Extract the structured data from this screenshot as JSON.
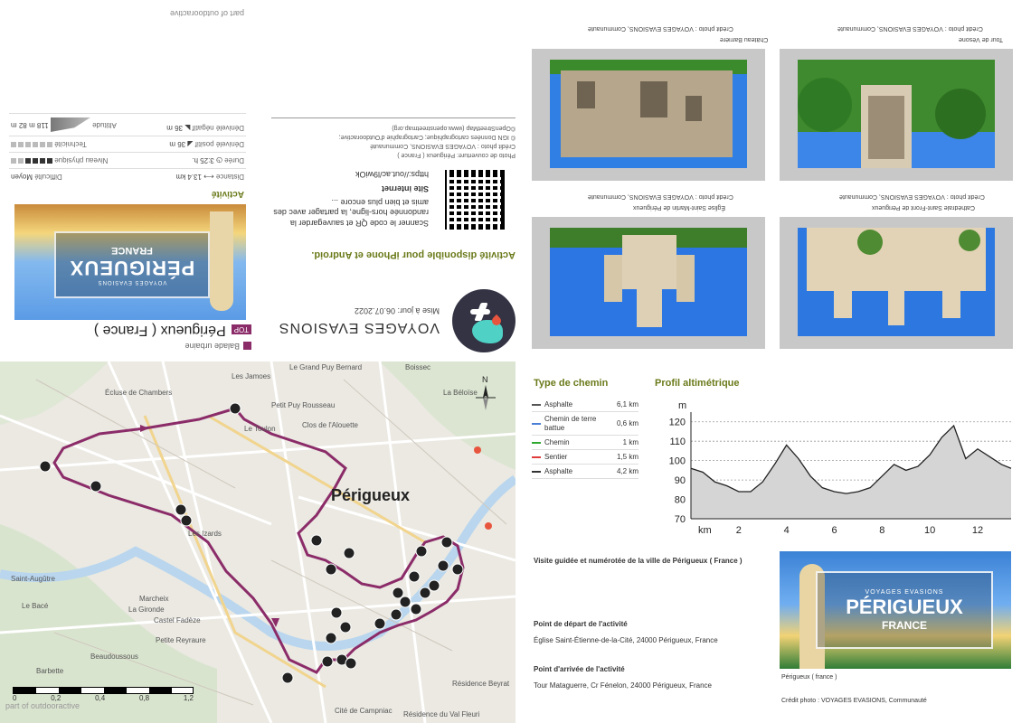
{
  "brand": {
    "name": "VOYAGES EVASIONS",
    "updated": "Mise à jour: 06.07.2022"
  },
  "activity_type": "Balade urbaine",
  "top_badge": "TOP",
  "title": "Périgueux ( France )",
  "cover": {
    "top_text": "VOYAGES EVASIONS",
    "big_text": "PÉRIGUEUX",
    "small_text": "FRANCE"
  },
  "app_line": "Activité disponible pour iPhone et Android.",
  "qr_text": "Scanner le code QR et sauvegarder la randonnée hors-ligne, la partager avec des amis et bien plus encore ...",
  "site_heading": "Site internet",
  "site_url": "https://out.ac/l9wiOk",
  "credits": {
    "line1": "Photo de couverture: Périgueux ( France )",
    "line2": "Crédit photo : VOYAGES EVASIONS, Communauté",
    "line3": "© IGN Données cartographique; Cartographie d'Outdooractive;",
    "line4": "©OpenStreetMap (www.openstreetmap.org)"
  },
  "activity_heading": "Activité",
  "stats": {
    "distance_label": "Distance",
    "distance": "13.4 km",
    "difficulty_label": "Difficulté",
    "difficulty": "Moyen",
    "duration_label": "Durée",
    "duration": "3:25 h.",
    "physical_label": "Niveau physique",
    "physical_level": 4,
    "physical_max": 6,
    "ascent_label": "Dénivelé positif",
    "ascent": "36 m",
    "technique_label": "Technicité",
    "technique_level": 0,
    "technique_max": 6,
    "descent_label": "Dénivelé négatif",
    "descent": "36 m",
    "altitude_label": "Altitude",
    "alt_max": "118 m",
    "alt_min": "82 m"
  },
  "outdoor_footer": "part of outdooractive",
  "map": {
    "city": "Périgueux",
    "labels": [
      "Le Grand Puy Bernard",
      "Les Jamoes",
      "Écluse de Chambers",
      "Petit Puy Rousseau",
      "Clos de l'Alouette",
      "Boissec",
      "Saint-Augûtre",
      "Le Toulon",
      "La Béloïse",
      "Cité de Campniac",
      "Résidence du Val Fleuri",
      "Résidence Beyrat",
      "Marcheix",
      "La Gironde",
      "Castel Fadèze",
      "Petite Reyraure",
      "Beaudoussous",
      "Barbette",
      "Le Bacé",
      "Les Izards"
    ],
    "scale": [
      "0",
      "0,2",
      "0,4",
      "0,8",
      "1,2"
    ],
    "watermark": "part of outdooractive"
  },
  "photos": [
    {
      "title": "Tour de Vésone",
      "credit": "Crédit photo : VOYAGES EVASIONS, Communauté"
    },
    {
      "title": "Château Barrière",
      "credit": "Crédit photo : VOYAGES EVASIONS, Communauté"
    },
    {
      "title": "Cathédrale Saint-Front de Périgueux",
      "credit": "Crédit photo : VOYAGES EVASIONS, Communauté"
    },
    {
      "title": "Église Saint-Martin de Périgueux",
      "credit": "Crédit photo : VOYAGES EVASIONS, Communauté"
    }
  ],
  "path_types": {
    "title": "Type de chemin",
    "items": [
      {
        "name": "Asphalte",
        "length": "6,1 km",
        "color": "#555555"
      },
      {
        "name": "Chemin de terre battue",
        "length": "0,6 km",
        "color": "#4a7fd6"
      },
      {
        "name": "Chemin",
        "length": "1 km",
        "color": "#2fa82f"
      },
      {
        "name": "Sentier",
        "length": "1,5 km",
        "color": "#e03c3c"
      },
      {
        "name": "Asphalte",
        "length": "4,2 km",
        "color": "#333333"
      }
    ]
  },
  "profile": {
    "title": "Profil altimétrique",
    "y_unit": "m",
    "x_unit": "km"
  },
  "chart_data": {
    "type": "area",
    "title": "Profil altimétrique",
    "xlabel": "km",
    "ylabel": "m",
    "xlim": [
      0,
      13.4
    ],
    "ylim": [
      70,
      125
    ],
    "x_ticks": [
      2,
      4,
      6,
      8,
      10,
      12
    ],
    "y_ticks": [
      70,
      80,
      90,
      100,
      110,
      120
    ],
    "x": [
      0,
      0.5,
      1,
      1.5,
      2,
      2.5,
      3,
      3.5,
      4,
      4.5,
      5,
      5.5,
      6,
      6.5,
      7,
      7.5,
      8,
      8.5,
      9,
      9.5,
      10,
      10.5,
      11,
      11.5,
      12,
      12.5,
      13,
      13.4
    ],
    "values": [
      96,
      94,
      89,
      87,
      84,
      84,
      89,
      98,
      108,
      101,
      92,
      86,
      84,
      83,
      84,
      86,
      92,
      98,
      95,
      97,
      103,
      112,
      118,
      101,
      106,
      102,
      98,
      96
    ],
    "grid": true
  },
  "info": {
    "description": "Visite guidée et numérotée de la ville de Périgueux ( France )",
    "start_label": "Point de départ de l'activité",
    "start": "Église Saint-Étienne-de-la-Cité, 24000 Périgueux, France",
    "end_label": "Point d'arrivée de l'activité",
    "end": "Tour Mataguerre, Cr Fénelon, 24000 Périgueux, France"
  },
  "bottom_image": {
    "top_text": "VOYAGES EVASIONS",
    "big_text": "PÉRIGUEUX",
    "small_text": "FRANCE",
    "caption": "Périgueux ( france )",
    "credit": "Crédit photo : VOYAGES EVASIONS, Communauté"
  }
}
